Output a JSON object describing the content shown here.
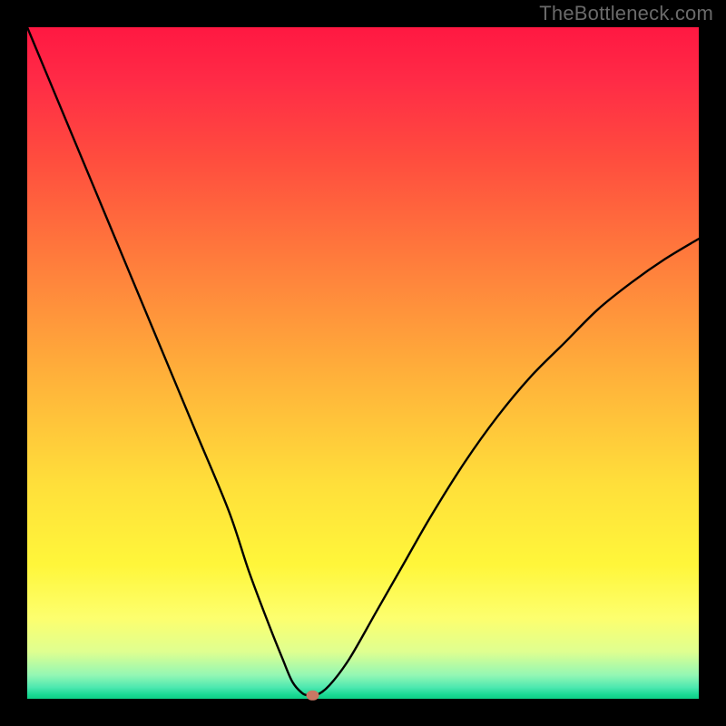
{
  "watermark": "TheBottleneck.com",
  "colors": {
    "page_bg": "#000000",
    "curve_stroke": "#000000",
    "marker_fill": "#c87864",
    "watermark_color": "#6a6a6a"
  },
  "chart_data": {
    "type": "line",
    "title": "",
    "xlabel": "",
    "ylabel": "",
    "xlim": [
      0,
      100
    ],
    "ylim": [
      0,
      100
    ],
    "grid": false,
    "legend": false,
    "series": [
      {
        "name": "bottleneck-curve",
        "x": [
          0,
          5,
          10,
          15,
          20,
          25,
          30,
          33,
          36,
          38,
          39.5,
          41,
          42,
          43,
          45,
          48,
          52,
          56,
          60,
          65,
          70,
          75,
          80,
          85,
          90,
          95,
          100
        ],
        "y": [
          100,
          88,
          76,
          64,
          52,
          40,
          28,
          19,
          11,
          6,
          2.5,
          0.8,
          0.5,
          0.5,
          2,
          6,
          13,
          20,
          27,
          35,
          42,
          48,
          53,
          58,
          62,
          65.5,
          68.5
        ]
      }
    ],
    "marker": {
      "x": 42.5,
      "y": 0.5
    },
    "gradient_stops": [
      {
        "pos": 0.0,
        "color": "#ff1842"
      },
      {
        "pos": 0.2,
        "color": "#ff4e3e"
      },
      {
        "pos": 0.52,
        "color": "#ffb13a"
      },
      {
        "pos": 0.8,
        "color": "#fff63a"
      },
      {
        "pos": 0.93,
        "color": "#dfff90"
      },
      {
        "pos": 1.0,
        "color": "#0fce86"
      }
    ]
  }
}
